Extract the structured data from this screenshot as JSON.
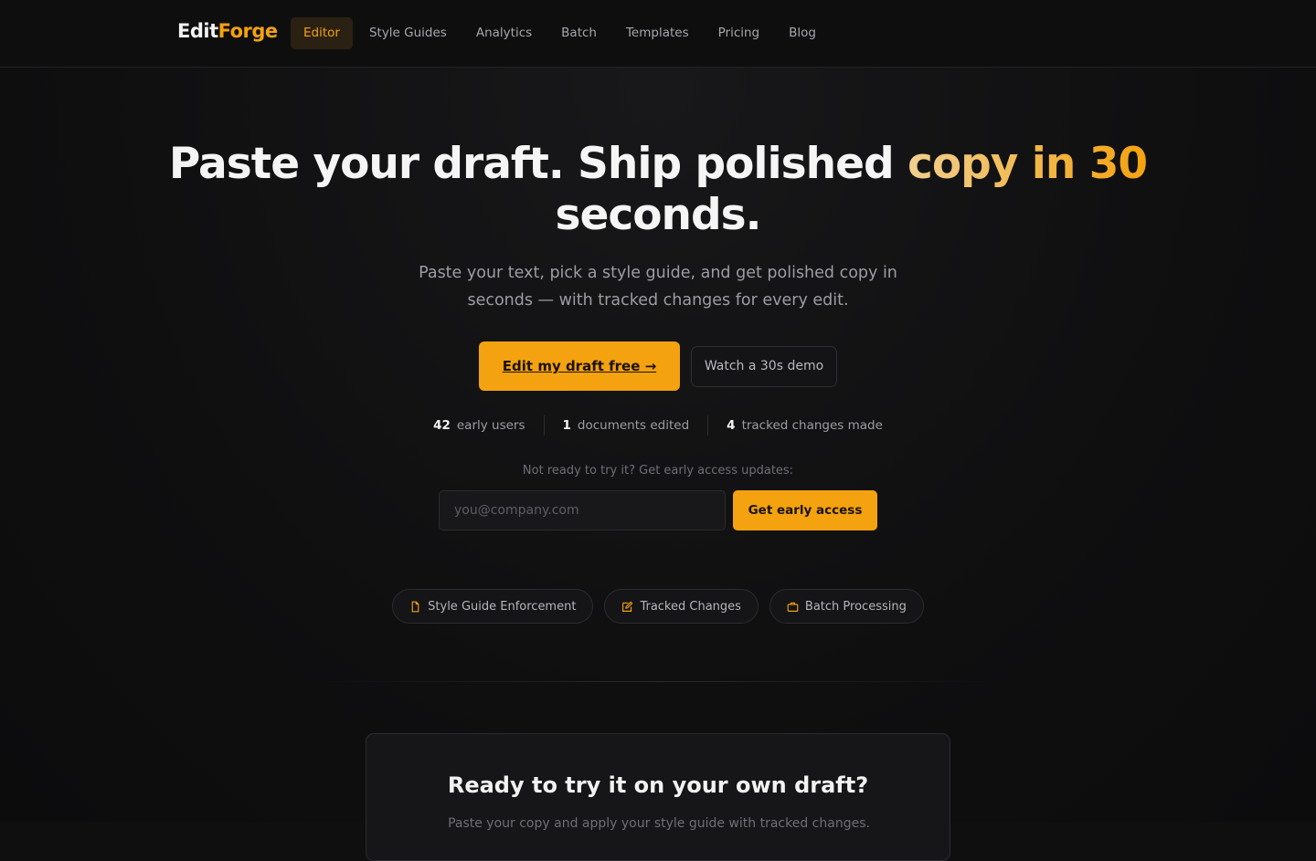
{
  "brand": {
    "part1": "Edit",
    "part2": "Forge"
  },
  "nav": [
    {
      "label": "Editor",
      "active": true
    },
    {
      "label": "Style Guides"
    },
    {
      "label": "Analytics"
    },
    {
      "label": "Batch"
    },
    {
      "label": "Templates"
    },
    {
      "label": "Pricing"
    },
    {
      "label": "Blog"
    }
  ],
  "hero": {
    "title_main": "Paste your draft. Ship polished ",
    "title_highlight": "copy in 30",
    "title_end": "seconds.",
    "subtitle": "Paste your text, pick a style guide, and get polished copy in seconds — with tracked changes for every edit.",
    "primary_cta": "Edit my draft free →",
    "secondary_cta": "Watch a 30s demo"
  },
  "stats": [
    {
      "value": "42",
      "label": "early users"
    },
    {
      "value": "1",
      "label": "documents edited"
    },
    {
      "value": "4",
      "label": "tracked changes made"
    }
  ],
  "signup": {
    "prompt": "Not ready to try it? Get early access updates:",
    "placeholder": "you@company.com",
    "button": "Get early access"
  },
  "features": [
    {
      "label": "Style Guide Enforcement",
      "icon": "document-icon"
    },
    {
      "label": "Tracked Changes",
      "icon": "edit-icon"
    },
    {
      "label": "Batch Processing",
      "icon": "briefcase-icon"
    }
  ],
  "cta_card": {
    "title": "Ready to try it on your own draft?",
    "text": "Paste your copy and apply your style guide with tracked changes."
  },
  "colors": {
    "accent": "#f4a20f",
    "background": "#0f0f10"
  }
}
